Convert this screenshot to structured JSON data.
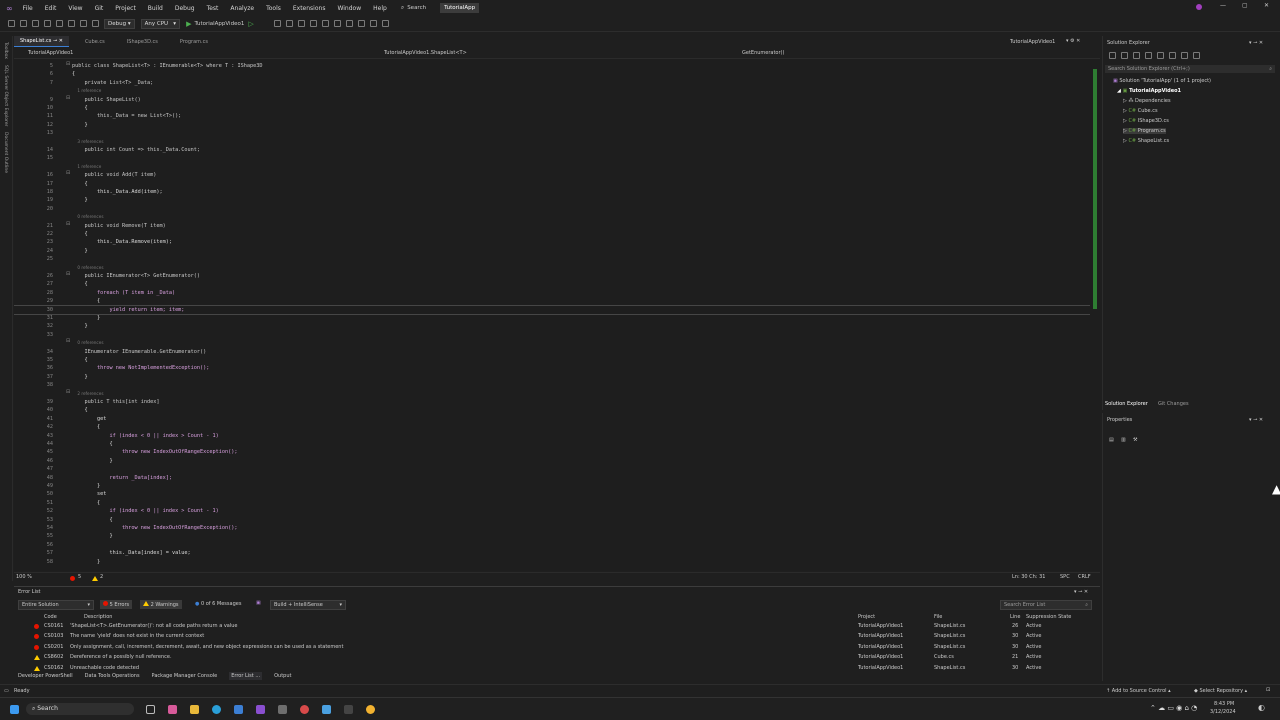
{
  "titlebar": {
    "menu": [
      "File",
      "Edit",
      "View",
      "Git",
      "Project",
      "Build",
      "Debug",
      "Test",
      "Analyze",
      "Tools",
      "Extensions",
      "Window",
      "Help"
    ],
    "search": "Search",
    "app_name": "TutorialApp"
  },
  "toolbar": {
    "config": "Debug",
    "platform": "Any CPU",
    "run_target": "TutorialAppVideo1"
  },
  "leftrail": [
    "Toolbox",
    "SQL Server Object Explorer",
    "Document Outline"
  ],
  "tabs": [
    {
      "label": "ShapeList.cs",
      "active": true
    },
    {
      "label": "Cube.cs",
      "active": false
    },
    {
      "label": "IShape3D.cs",
      "active": false
    },
    {
      "label": "Program.cs",
      "active": false
    }
  ],
  "tabs_right": "TutorialAppVideo1",
  "navbar": {
    "project": "TutorialAppVideo1",
    "type": "TutorialAppVideo1.ShapeList<T>",
    "member": "GetEnumerator()"
  },
  "code": [
    {
      "n": "5",
      "t": "public class ShapeList<T> : IEnumerable<T> where T : IShape3D"
    },
    {
      "n": "6",
      "t": "{"
    },
    {
      "n": "7",
      "t": "    private List<T> _Data;"
    },
    {
      "n": "",
      "t": "    1 reference",
      "ref": true
    },
    {
      "n": "9",
      "t": "    public ShapeList()"
    },
    {
      "n": "10",
      "t": "    {"
    },
    {
      "n": "11",
      "t": "        this._Data = new List<T>();"
    },
    {
      "n": "12",
      "t": "    }"
    },
    {
      "n": "13",
      "t": ""
    },
    {
      "n": "",
      "t": "    3 references",
      "ref": true
    },
    {
      "n": "14",
      "t": "    public int Count => this._Data.Count;"
    },
    {
      "n": "15",
      "t": ""
    },
    {
      "n": "",
      "t": "    1 reference",
      "ref": true
    },
    {
      "n": "16",
      "t": "    public void Add(T item)"
    },
    {
      "n": "17",
      "t": "    {"
    },
    {
      "n": "18",
      "t": "        this._Data.Add(item);"
    },
    {
      "n": "19",
      "t": "    }"
    },
    {
      "n": "20",
      "t": ""
    },
    {
      "n": "",
      "t": "    0 references",
      "ref": true
    },
    {
      "n": "21",
      "t": "    public void Remove(T item)"
    },
    {
      "n": "22",
      "t": "    {"
    },
    {
      "n": "23",
      "t": "        this._Data.Remove(item);"
    },
    {
      "n": "24",
      "t": "    }"
    },
    {
      "n": "25",
      "t": ""
    },
    {
      "n": "",
      "t": "    0 references",
      "ref": true
    },
    {
      "n": "26",
      "t": "    public IEnumerator<T> GetEnumerator()"
    },
    {
      "n": "27",
      "t": "    {"
    },
    {
      "n": "28",
      "t": "        foreach (T item in _Data)"
    },
    {
      "n": "29",
      "t": "        {"
    },
    {
      "n": "30",
      "t": "            yield return item; item;",
      "cur": true
    },
    {
      "n": "31",
      "t": "        }"
    },
    {
      "n": "32",
      "t": "    }"
    },
    {
      "n": "33",
      "t": ""
    },
    {
      "n": "",
      "t": "    0 references",
      "ref": true
    },
    {
      "n": "34",
      "t": "    IEnumerator IEnumerable.GetEnumerator()"
    },
    {
      "n": "35",
      "t": "    {"
    },
    {
      "n": "36",
      "t": "        throw new NotImplementedException();"
    },
    {
      "n": "37",
      "t": "    }"
    },
    {
      "n": "38",
      "t": ""
    },
    {
      "n": "",
      "t": "    2 references",
      "ref": true
    },
    {
      "n": "39",
      "t": "    public T this[int index]"
    },
    {
      "n": "40",
      "t": "    {"
    },
    {
      "n": "41",
      "t": "        get"
    },
    {
      "n": "42",
      "t": "        {"
    },
    {
      "n": "43",
      "t": "            if (index < 0 || index > Count - 1)"
    },
    {
      "n": "44",
      "t": "            {"
    },
    {
      "n": "45",
      "t": "                throw new IndexOutOfRangeException();"
    },
    {
      "n": "46",
      "t": "            }"
    },
    {
      "n": "47",
      "t": ""
    },
    {
      "n": "48",
      "t": "            return _Data[index];"
    },
    {
      "n": "49",
      "t": "        }"
    },
    {
      "n": "50",
      "t": "        set"
    },
    {
      "n": "51",
      "t": "        {"
    },
    {
      "n": "52",
      "t": "            if (index < 0 || index > Count - 1)"
    },
    {
      "n": "53",
      "t": "            {"
    },
    {
      "n": "54",
      "t": "                throw new IndexOutOfRangeException();"
    },
    {
      "n": "55",
      "t": "            }"
    },
    {
      "n": "56",
      "t": ""
    },
    {
      "n": "57",
      "t": "            this._Data[index] = value;"
    },
    {
      "n": "58",
      "t": "        }"
    }
  ],
  "editor_status": {
    "zoom": "100 %",
    "errors": "5",
    "warnings": "2",
    "position": "Ln: 30   Ch: 31",
    "spc": "SPC",
    "crlf": "CRLF"
  },
  "errorlist": {
    "title": "Error List",
    "scope": "Entire Solution",
    "errors_btn": "5 Errors",
    "warnings_btn": "2 Warnings",
    "messages_btn": "0 of 6 Messages",
    "build_filter": "Build + IntelliSense",
    "search_placeholder": "Search Error List",
    "columns": [
      "Code",
      "Description",
      "Project",
      "File",
      "Line",
      "Suppression State"
    ],
    "rows": [
      {
        "kind": "error",
        "code": "CS0161",
        "desc": "'ShapeList<T>.GetEnumerator()': not all code paths return a value",
        "project": "TutorialAppVideo1",
        "file": "ShapeList.cs",
        "line": "26",
        "state": "Active"
      },
      {
        "kind": "error",
        "code": "CS0103",
        "desc": "The name 'yield' does not exist in the current context",
        "project": "TutorialAppVideo1",
        "file": "ShapeList.cs",
        "line": "30",
        "state": "Active"
      },
      {
        "kind": "error",
        "code": "CS0201",
        "desc": "Only assignment, call, increment, decrement, await, and new object expressions can be used as a statement",
        "project": "TutorialAppVideo1",
        "file": "ShapeList.cs",
        "line": "30",
        "state": "Active"
      },
      {
        "kind": "warning",
        "code": "CS8602",
        "desc": "Dereference of a possibly null reference.",
        "project": "TutorialAppVideo1",
        "file": "Cube.cs",
        "line": "21",
        "state": "Active"
      },
      {
        "kind": "warning",
        "code": "CS0162",
        "desc": "Unreachable code detected",
        "project": "TutorialAppVideo1",
        "file": "ShapeList.cs",
        "line": "30",
        "state": "Active"
      }
    ]
  },
  "bottom_tabs": [
    "Developer PowerShell",
    "Data Tools Operations",
    "Package Manager Console",
    "Error List ...",
    "Output"
  ],
  "solution_explorer": {
    "title": "Solution Explorer",
    "search_placeholder": "Search Solution Explorer (Ctrl+;)",
    "solution": "Solution 'TutorialApp' (1 of 1 project)",
    "project": "TutorialAppVideo1",
    "items": [
      "Dependencies",
      "Cube.cs",
      "IShape3D.cs",
      "Program.cs",
      "ShapeList.cs"
    ],
    "tab_active": "Solution Explorer",
    "tab_other": "Git Changes"
  },
  "properties": {
    "title": "Properties"
  },
  "statusbar": {
    "ready": "Ready",
    "source_control": "Add to Source Control",
    "repo": "Select Repository"
  },
  "taskbar": {
    "search": "Search",
    "time": "8:43 PM",
    "date": "3/12/2024"
  },
  "colors": {
    "accent": "#3c7fd4",
    "error": "#e51400",
    "warning": "#ffcc00",
    "change_bar": "#2e7d32"
  }
}
